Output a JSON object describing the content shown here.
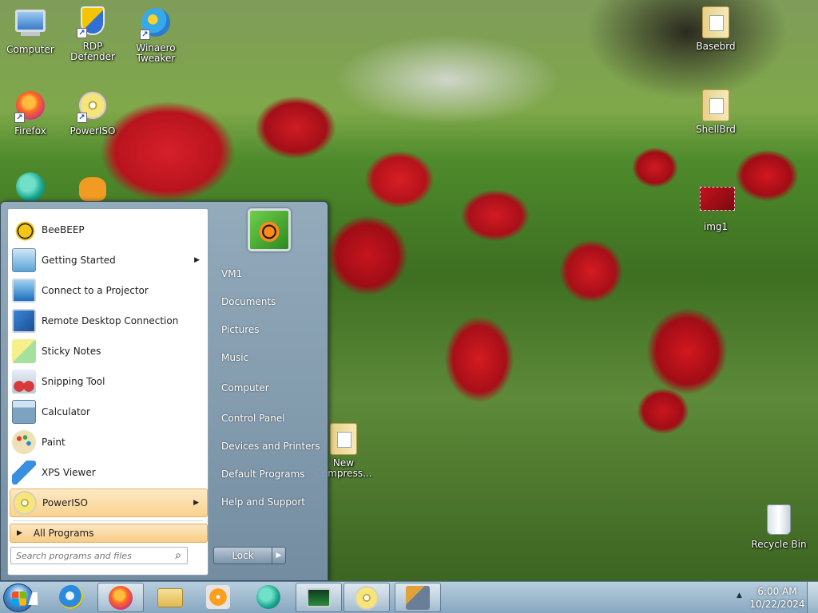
{
  "desktop": {
    "icons": [
      {
        "name": "computer-icon",
        "label": "Computer"
      },
      {
        "name": "rdp-defender-icon",
        "label": "RDP Defender"
      },
      {
        "name": "winaero-tweaker-icon",
        "label": "Winaero Tweaker"
      },
      {
        "name": "basebrd-folder-icon",
        "label": "Basebrd"
      },
      {
        "name": "firefox-icon",
        "label": "Firefox"
      },
      {
        "name": "poweriso-icon",
        "label": "PowerISO"
      },
      {
        "name": "shellbrd-folder-icon",
        "label": "ShellBrd"
      },
      {
        "name": "img1-icon",
        "label": "img1"
      },
      {
        "name": "new-compressed-folder-icon",
        "label": "New Compress..."
      },
      {
        "name": "recycle-bin-icon",
        "label": "Recycle Bin"
      }
    ]
  },
  "start_menu": {
    "programs": [
      {
        "label": "BeeBEEP",
        "icon": "bee-icon",
        "submenu": false
      },
      {
        "label": "Getting Started",
        "icon": "getting-started-icon",
        "submenu": true
      },
      {
        "label": "Connect to a Projector",
        "icon": "projector-icon",
        "submenu": false
      },
      {
        "label": "Remote Desktop Connection",
        "icon": "remote-desktop-icon",
        "submenu": false
      },
      {
        "label": "Sticky Notes",
        "icon": "sticky-notes-icon",
        "submenu": false
      },
      {
        "label": "Snipping Tool",
        "icon": "scissors-icon",
        "submenu": false
      },
      {
        "label": "Calculator",
        "icon": "calculator-icon",
        "submenu": false
      },
      {
        "label": "Paint",
        "icon": "paint-palette-icon",
        "submenu": false
      },
      {
        "label": "XPS Viewer",
        "icon": "xps-viewer-icon",
        "submenu": false
      },
      {
        "label": "PowerISO",
        "icon": "poweriso-disc-icon",
        "submenu": true,
        "highlighted": true
      }
    ],
    "all_programs": "All Programs",
    "search_placeholder": "Search programs and files",
    "right_items": [
      "VM1",
      "Documents",
      "Pictures",
      "Music",
      "Computer",
      "Control Panel",
      "Devices and Printers",
      "Default Programs",
      "Help and Support"
    ],
    "lock_label": "Lock"
  },
  "taskbar": {
    "pinned": [
      "internet-explorer-icon",
      "firefox-icon",
      "file-explorer-icon",
      "media-player-icon",
      "teal-app-icon",
      "system-monitor-icon",
      "poweriso-icon",
      "tool-icon"
    ],
    "time": "6:00 AM",
    "date": "10/22/2024"
  }
}
